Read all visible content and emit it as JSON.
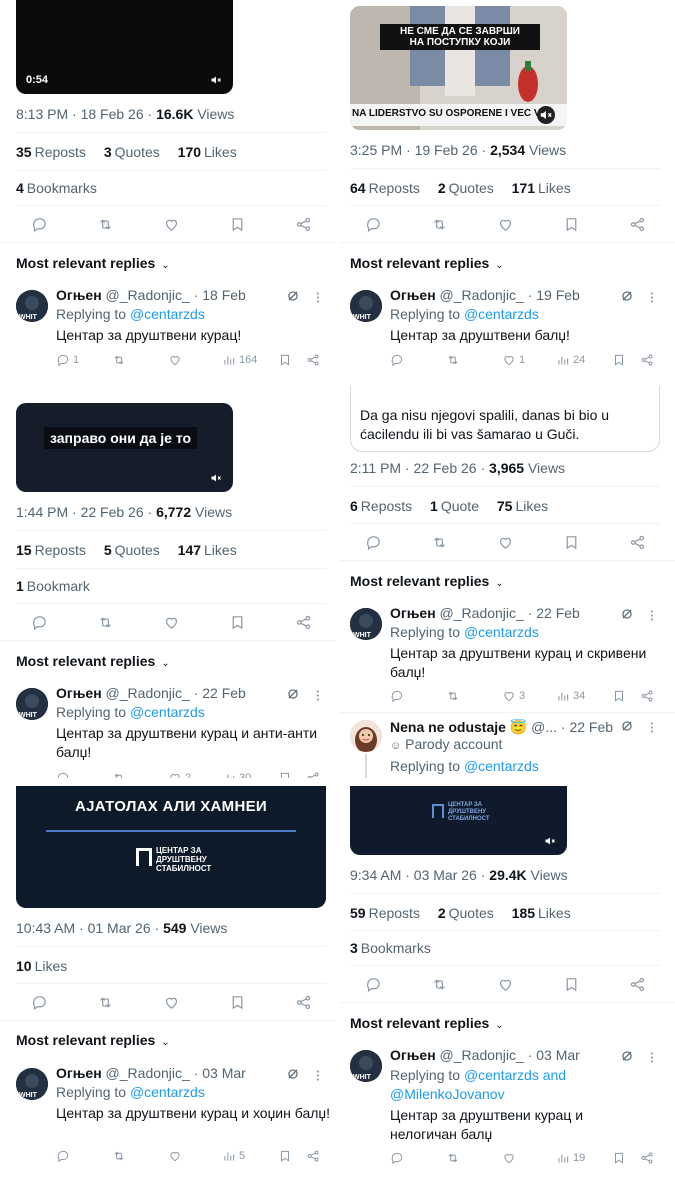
{
  "panels": [
    {
      "id": "p1",
      "media": {
        "duration": "0:54",
        "caption": ""
      },
      "meta": {
        "time": "8:13 PM · 18 Feb 26 · ",
        "views": "16.6K",
        "views_label": " Views"
      },
      "stats": [
        {
          "n": "35",
          "l": "Reposts"
        },
        {
          "n": "3",
          "l": "Quotes"
        },
        {
          "n": "170",
          "l": "Likes"
        }
      ],
      "bookmarks": {
        "n": "4",
        "l": "Bookmarks"
      },
      "most_relevant": "Most relevant replies",
      "reply": {
        "name": "Огњен",
        "handle": "@_Radonjic_ · 18 Feb",
        "replying": "Replying to ",
        "to": "@centarzds",
        "text": "Центар за друштвени курац!",
        "replies": "1",
        "likes": "",
        "views": "164"
      }
    },
    {
      "id": "p2",
      "media": {
        "caption_top": "НЕ СМЕ ДА СЕ ЗАВРШИ\nНА ПОСТУПКУ КОЈИ",
        "caption_bottom": "NA LIDERSTVO SU OSPORENE I VEĆ VA"
      },
      "meta": {
        "time": "3:25 PM · 19 Feb 26 · ",
        "views": "2,534",
        "views_label": " Views"
      },
      "stats": [
        {
          "n": "64",
          "l": "Reposts"
        },
        {
          "n": "2",
          "l": "Quotes"
        },
        {
          "n": "171",
          "l": "Likes"
        }
      ],
      "most_relevant": "Most relevant replies",
      "reply": {
        "name": "Огњен",
        "handle": "@_Radonjic_ · 19 Feb",
        "replying": "Replying to ",
        "to": "@centarzds",
        "text": "Центар за друштвени балџ!",
        "replies": "",
        "likes": "1",
        "views": "24"
      }
    },
    {
      "id": "p3",
      "media": {
        "caption": "заправо они да је то"
      },
      "meta": {
        "time": "1:44 PM · 22 Feb 26 · ",
        "views": "6,772",
        "views_label": " Views"
      },
      "stats": [
        {
          "n": "15",
          "l": "Reposts"
        },
        {
          "n": "5",
          "l": "Quotes"
        },
        {
          "n": "147",
          "l": "Likes"
        }
      ],
      "bookmarks": {
        "n": "1",
        "l": "Bookmark"
      },
      "most_relevant": "Most relevant replies",
      "reply": {
        "name": "Огњен",
        "handle": "@_Radonjic_ · 22 Feb",
        "replying": "Replying to ",
        "to": "@centarzds",
        "text": "Центар за друштвени курац и анти-анти балџ!",
        "replies": "",
        "likes": "2",
        "views": "30"
      }
    },
    {
      "id": "p4",
      "quote_text": "Da ga nisu njegovi spalili, danas bi bio u ćacilendu ili bi vas šamarao u Guči.",
      "meta": {
        "time": "2:11 PM · 22 Feb 26 · ",
        "views": "3,965",
        "views_label": " Views"
      },
      "stats": [
        {
          "n": "6",
          "l": "Reposts"
        },
        {
          "n": "1",
          "l": "Quote"
        },
        {
          "n": "75",
          "l": "Likes"
        }
      ],
      "most_relevant": "Most relevant replies",
      "reply": {
        "name": "Огњен",
        "handle": "@_Radonjic_ · 22 Feb",
        "replying": "Replying to ",
        "to": "@centarzds",
        "text": "Центар за друштвени курац и скривени балџ!",
        "replies": "",
        "likes": "3",
        "views": "34"
      },
      "reply2": {
        "name": "Nena ne odustaje 😇",
        "handle": "@... · 22 Feb",
        "parody": "Parody account",
        "replying": "Replying to ",
        "to": "@centarzds"
      }
    },
    {
      "id": "p5",
      "media": {
        "caption": "АЈАТОЛАХ АЛИ ХАМНЕИ",
        "logo": "ЦЕНТАР ЗА\nДРУШТВЕНУ\nСТАБИЛНОСТ"
      },
      "meta": {
        "time": "10:43 AM · 01 Mar 26 · ",
        "views": "549",
        "views_label": " Views"
      },
      "stats": [
        {
          "n": "10",
          "l": "Likes"
        }
      ],
      "most_relevant": "Most relevant replies",
      "reply": {
        "name": "Огњен",
        "handle": "@_Radonjic_ · 03 Mar",
        "replying": "Replying to ",
        "to": "@centarzds",
        "text": "Центар за друштвени курац и хоџин балџ!",
        "replies": "",
        "likes": "",
        "views": "5"
      }
    },
    {
      "id": "p6",
      "media": {
        "logo": "ЦЕНТАР ЗА\nДРУШТВЕНУ\nСТАБИЛНОСТ"
      },
      "meta": {
        "time": "9:34 AM · 03 Mar 26 · ",
        "views": "29.4K",
        "views_label": " Views"
      },
      "stats": [
        {
          "n": "59",
          "l": "Reposts"
        },
        {
          "n": "2",
          "l": "Quotes"
        },
        {
          "n": "185",
          "l": "Likes"
        }
      ],
      "bookmarks": {
        "n": "3",
        "l": "Bookmarks"
      },
      "most_relevant": "Most relevant replies",
      "reply": {
        "name": "Огњен",
        "handle": "@_Radonjic_ · 03 Mar",
        "replying": "Replying to ",
        "to": "@centarzds and @MilenkoJovanov",
        "text": "Центар за друштвени курац и нелогичан балџ",
        "replies": "",
        "likes": "",
        "views": "19"
      }
    }
  ],
  "colors": {
    "accent": "#1d9bf0",
    "muted": "#536471",
    "icon": "#8b98a5",
    "divider": "#eff3f4"
  }
}
